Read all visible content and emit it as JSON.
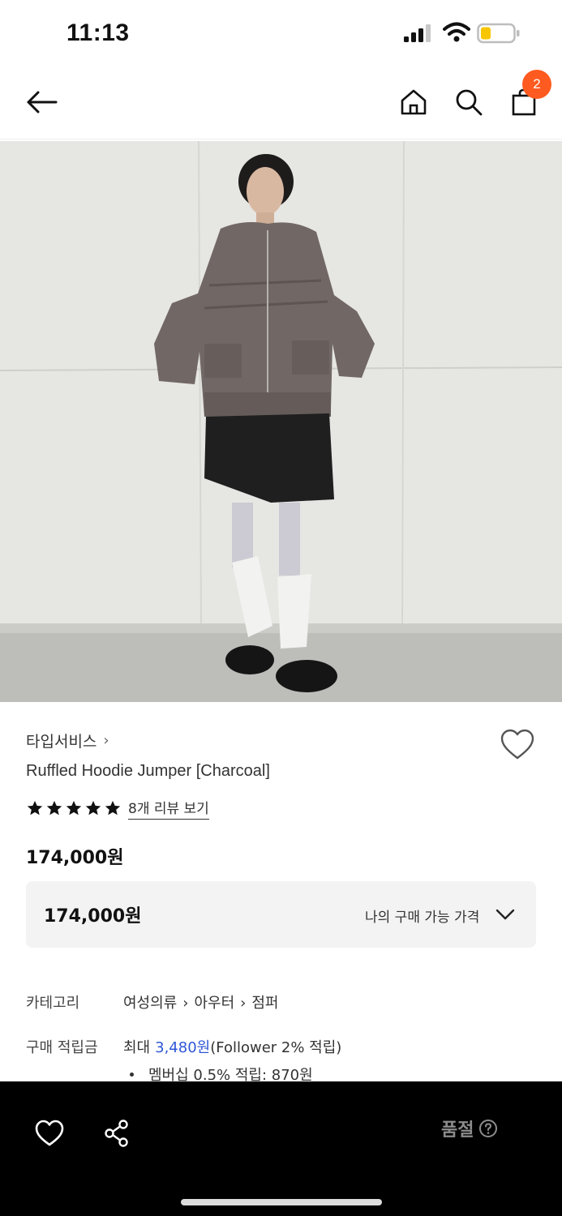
{
  "status_bar": {
    "time": "11:13"
  },
  "header": {
    "cart_count": "2"
  },
  "product": {
    "brand": "타입서비스",
    "name": "Ruffled Hoodie Jumper [Charcoal]",
    "rating_stars": 5,
    "review_link": "8개 리뷰 보기",
    "price": "174,000원"
  },
  "price_box": {
    "value": "174,000원",
    "label": "나의 구매 가능 가격"
  },
  "details": {
    "category_label": "카테고리",
    "category_path": [
      "여성의류",
      "아우터",
      "점퍼"
    ],
    "points_label": "구매 적립금",
    "points_prefix": "최대",
    "points_amount": "3,480원",
    "points_suffix": "(Follower 2% 적립)",
    "membership": "멤버십 0.5% 적립: 870원"
  },
  "bottom_bar": {
    "soldout_label": "품절"
  },
  "colors": {
    "accent": "#2f57d8",
    "badge": "#ff5a1f",
    "bottom_bar": "#000000"
  }
}
